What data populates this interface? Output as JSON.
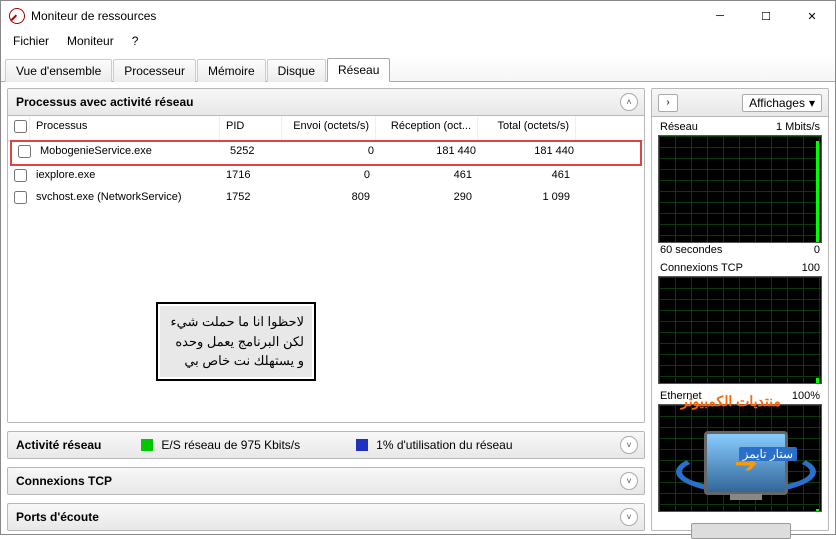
{
  "window": {
    "title": "Moniteur de ressources"
  },
  "menu": {
    "file": "Fichier",
    "monitor": "Moniteur",
    "help": "?"
  },
  "tabs": {
    "overview": "Vue d'ensemble",
    "cpu": "Processeur",
    "memory": "Mémoire",
    "disk": "Disque",
    "network": "Réseau"
  },
  "panels": {
    "processes": {
      "title": "Processus avec activité réseau",
      "columns": {
        "process": "Processus",
        "pid": "PID",
        "send": "Envoi (octets/s)",
        "recv": "Réception (oct...",
        "total": "Total (octets/s)"
      },
      "rows": [
        {
          "name": "MobogenieService.exe",
          "pid": "5252",
          "send": "0",
          "recv": "181 440",
          "total": "181 440",
          "highlight": true
        },
        {
          "name": "iexplore.exe",
          "pid": "1716",
          "send": "0",
          "recv": "461",
          "total": "461"
        },
        {
          "name": "svchost.exe (NetworkService)",
          "pid": "1752",
          "send": "809",
          "recv": "290",
          "total": "1 099"
        }
      ]
    },
    "network_activity": {
      "title": "Activité réseau",
      "io_label": "E/S réseau de 975 Kbits/s",
      "util_label": "1% d'utilisation du réseau",
      "io_color": "#00c800",
      "util_color": "#2030c0"
    },
    "tcp": {
      "title": "Connexions TCP"
    },
    "ports": {
      "title": "Ports d'écoute"
    }
  },
  "annotation": "لاحظوا انا ما حملت شيء لكن البرنامج يعمل وحده و يستهلك نت خاص بي",
  "sidebar": {
    "views_label": "Affichages",
    "charts": [
      {
        "top_left": "Réseau",
        "top_right": "1 Mbits/s",
        "bottom_left": "60 secondes",
        "bottom_right": "0",
        "spike_pct": 95
      },
      {
        "top_left": "Connexions TCP",
        "top_right": "100",
        "bottom_left": "",
        "bottom_right": "",
        "spike_pct": 5
      },
      {
        "top_left": "Ethernet",
        "top_right": "100%",
        "bottom_left": "",
        "bottom_right": "",
        "spike_pct": 2
      }
    ]
  },
  "logo": {
    "text1": "منتديات الكمبيوتر",
    "text2": "ستار تايمز"
  },
  "chart_data": {
    "type": "line",
    "title": "Réseau",
    "xlabel": "60 secondes",
    "ylabel": "1 Mbits/s",
    "x_range_seconds": [
      0,
      60
    ],
    "series": [
      {
        "name": "Réseau (Mbits/s)",
        "ylim": [
          0,
          1
        ],
        "values_latest_approx": 0.95
      },
      {
        "name": "Connexions TCP",
        "ylim": [
          0,
          100
        ],
        "values_latest_approx": 5
      },
      {
        "name": "Ethernet (%)",
        "ylim": [
          0,
          100
        ],
        "values_latest_approx": 2
      }
    ]
  }
}
